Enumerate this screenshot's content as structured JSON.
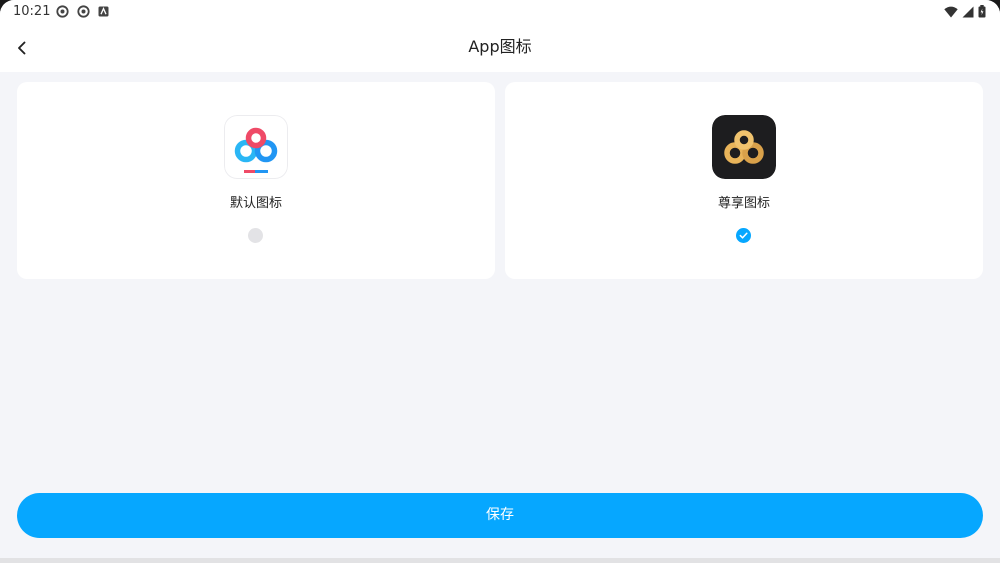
{
  "status_bar": {
    "time": "10:21",
    "left_icons": [
      "app-notification-icon",
      "app-notification-icon",
      "store-notification-icon"
    ],
    "right_icons": [
      "wifi-icon",
      "cellular-signal-icon",
      "battery-icon"
    ]
  },
  "header": {
    "title": "App图标",
    "back_icon": "chevron-left-icon"
  },
  "options": [
    {
      "label": "默认图标",
      "icon": "baidu-netdisk-default-icon",
      "selected": false
    },
    {
      "label": "尊享图标",
      "icon": "baidu-netdisk-premium-icon",
      "selected": true
    }
  ],
  "save_button": {
    "label": "保存"
  },
  "colors": {
    "accent": "#06a7ff",
    "background": "#f4f5f9",
    "card": "#ffffff",
    "premium_gold": "#e8b45a",
    "premium_bg": "#1d1d1f"
  }
}
